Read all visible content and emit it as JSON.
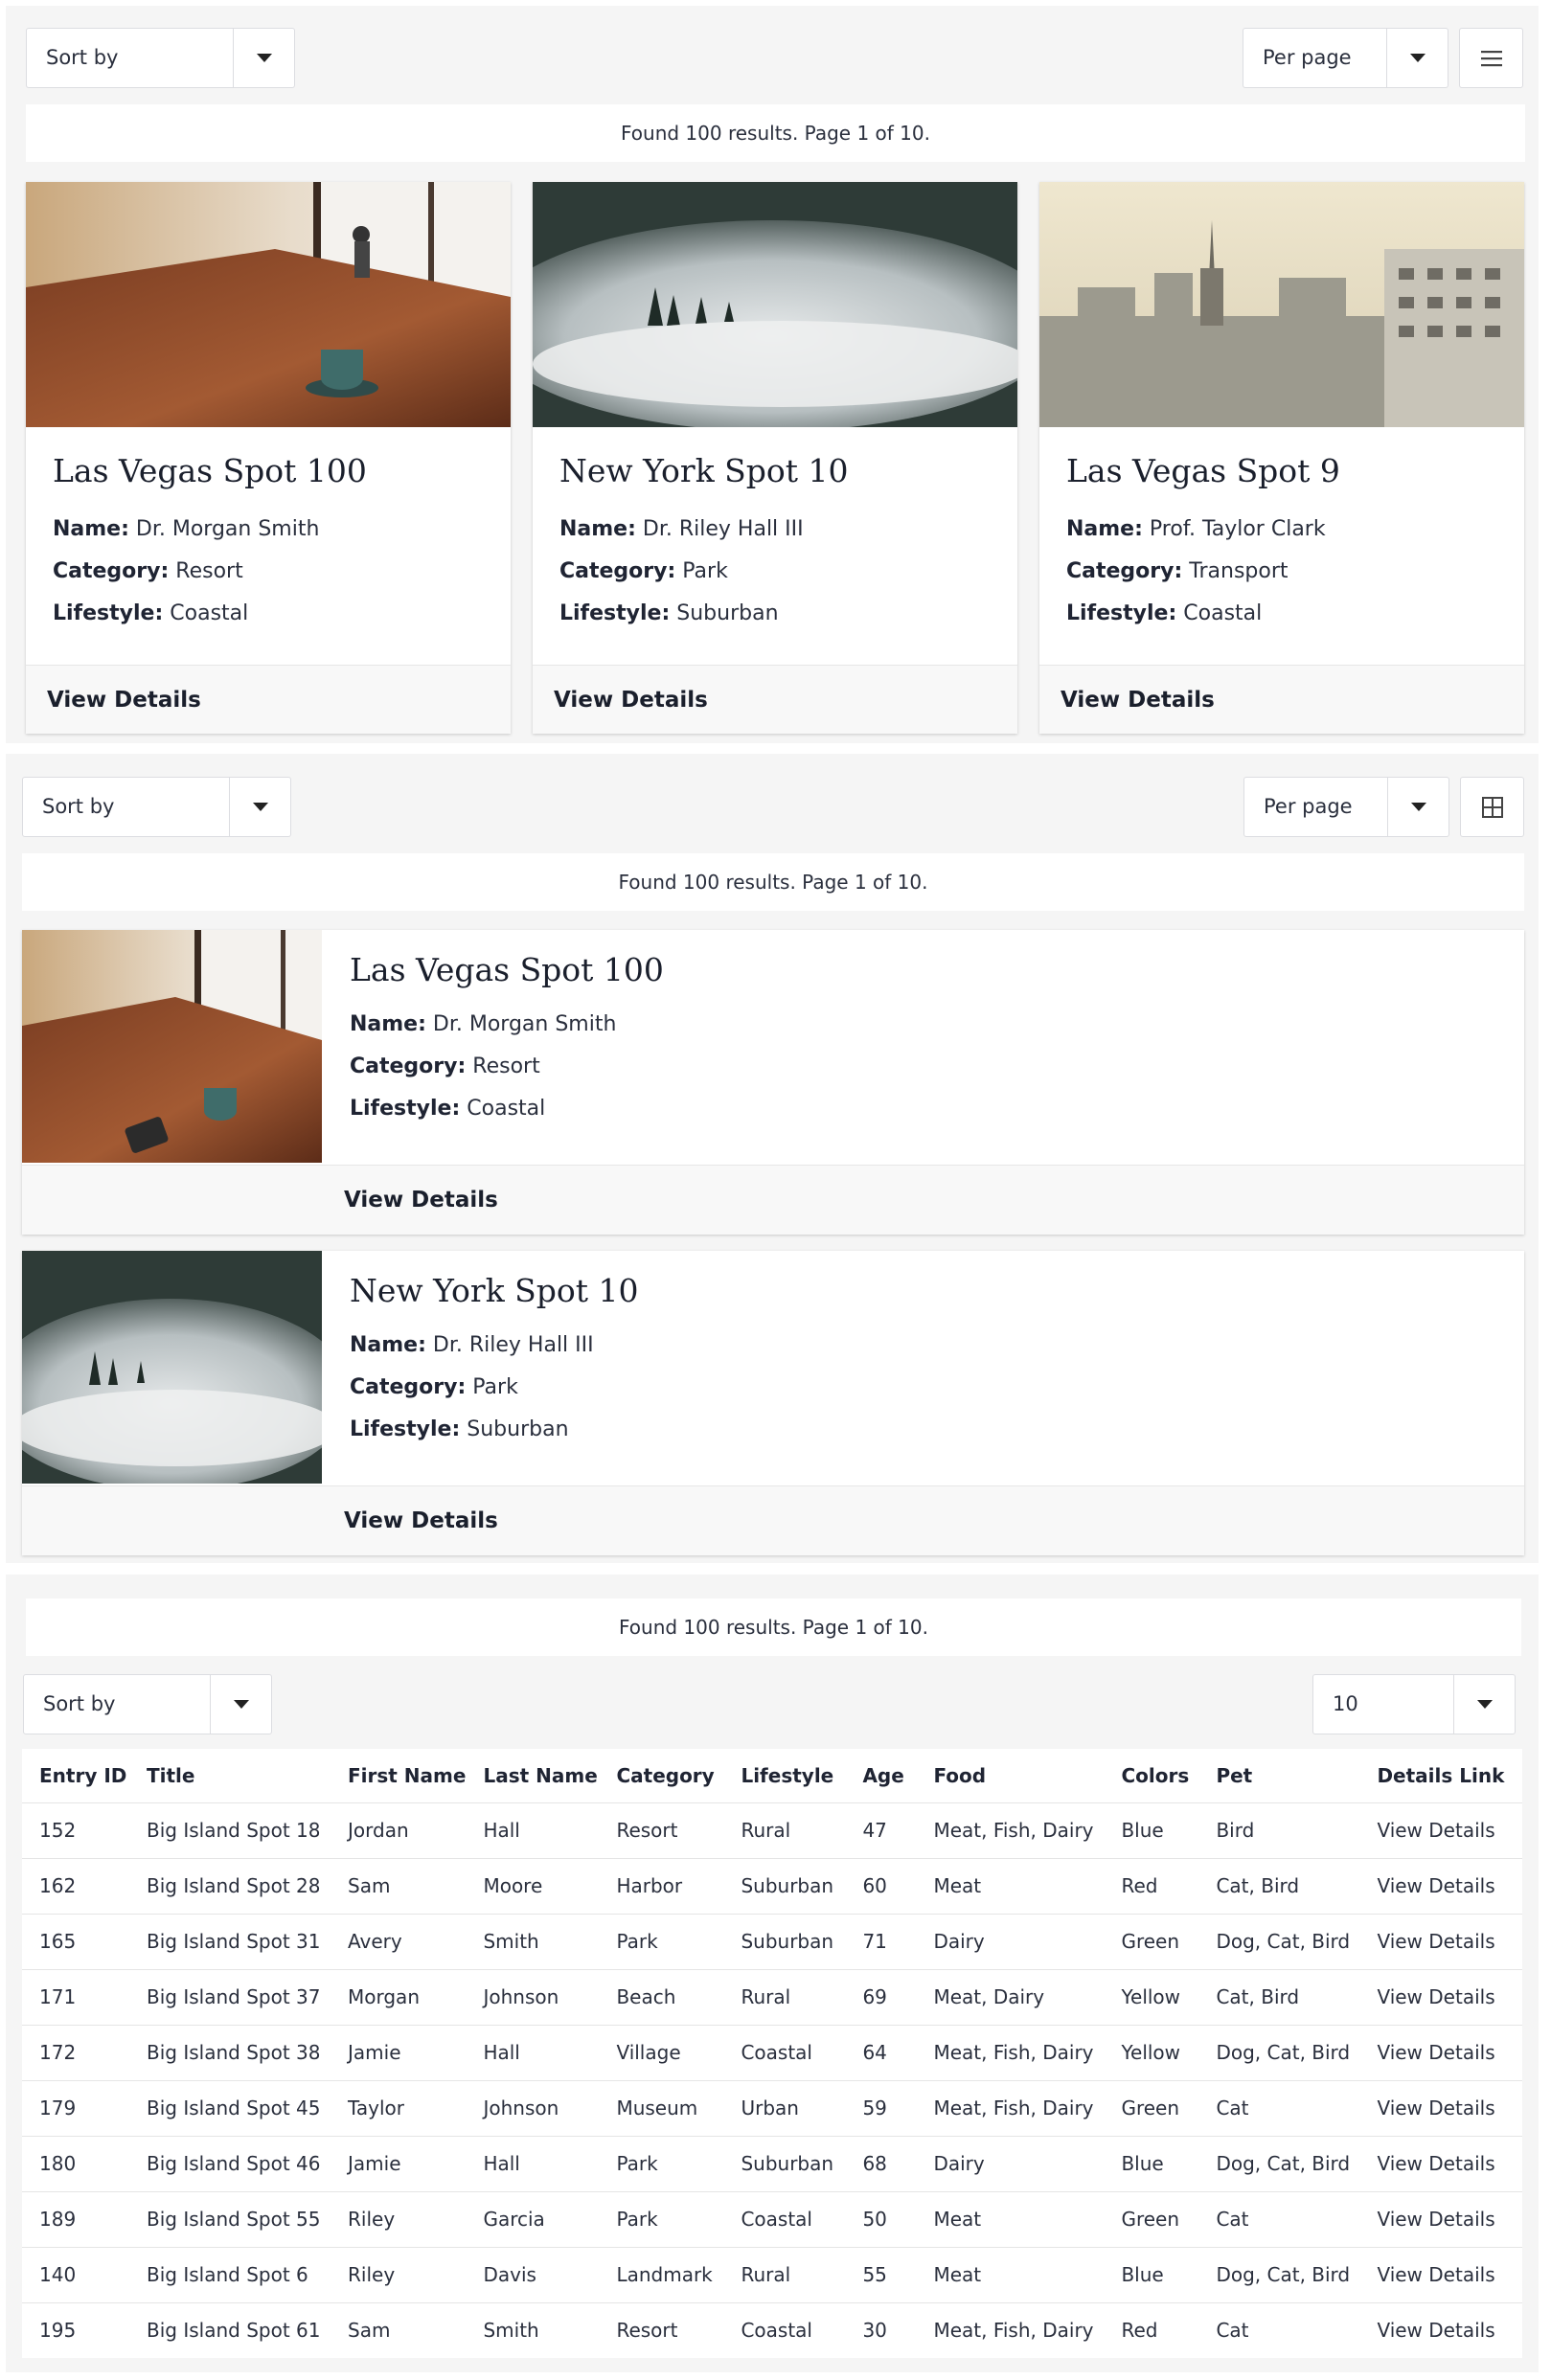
{
  "colors": {
    "bg_section": "#f5f5f5",
    "card_bg": "#ffffff",
    "text": "#1f2433"
  },
  "section1": {
    "sort_label": "Sort by",
    "per_page_label": "Per page",
    "toggle_icon": "list-view-icon",
    "results_text": "Found 100 results. Page 1 of 10.",
    "cards": [
      {
        "title": "Las Vegas Spot 100",
        "name_key": "Name:",
        "name": "Dr. Morgan Smith",
        "category_key": "Category:",
        "category": "Resort",
        "lifestyle_key": "Lifestyle:",
        "lifestyle": "Coastal",
        "link": "View Details",
        "image": "cafe-table-photo"
      },
      {
        "title": "New York Spot 10",
        "name_key": "Name:",
        "name": "Dr. Riley Hall III",
        "category_key": "Category:",
        "category": "Park",
        "lifestyle_key": "Lifestyle:",
        "lifestyle": "Suburban",
        "link": "View Details",
        "image": "foggy-forest-photo"
      },
      {
        "title": "Las Vegas Spot 9",
        "name_key": "Name:",
        "name": "Prof. Taylor Clark",
        "category_key": "Category:",
        "category": "Transport",
        "lifestyle_key": "Lifestyle:",
        "lifestyle": "Coastal",
        "link": "View Details",
        "image": "city-skyline-photo"
      }
    ]
  },
  "section2": {
    "sort_label": "Sort by",
    "per_page_label": "Per page",
    "toggle_icon": "grid-view-icon",
    "results_text": "Found 100 results. Page 1 of 10.",
    "cards": [
      {
        "title": "Las Vegas Spot 100",
        "name_key": "Name:",
        "name": "Dr. Morgan Smith",
        "category_key": "Category:",
        "category": "Resort",
        "lifestyle_key": "Lifestyle:",
        "lifestyle": "Coastal",
        "link": "View Details",
        "image": "cafe-table-photo"
      },
      {
        "title": "New York Spot 10",
        "name_key": "Name:",
        "name": "Dr. Riley Hall III",
        "category_key": "Category:",
        "category": "Park",
        "lifestyle_key": "Lifestyle:",
        "lifestyle": "Suburban",
        "link": "View Details",
        "image": "foggy-forest-photo"
      }
    ]
  },
  "section3": {
    "results_text": "Found 100 results. Page 1 of 10.",
    "sort_label": "Sort by",
    "per_page_value": "10",
    "columns": [
      "Entry ID",
      "Title",
      "First Name",
      "Last Name",
      "Category",
      "Lifestyle",
      "Age",
      "Food",
      "Colors",
      "Pet",
      "Details Link"
    ],
    "rows": [
      [
        "152",
        "Big Island Spot 18",
        "Jordan",
        "Hall",
        "Resort",
        "Rural",
        "47",
        "Meat, Fish, Dairy",
        "Blue",
        "Bird",
        "View Details"
      ],
      [
        "162",
        "Big Island Spot 28",
        "Sam",
        "Moore",
        "Harbor",
        "Suburban",
        "60",
        "Meat",
        "Red",
        "Cat, Bird",
        "View Details"
      ],
      [
        "165",
        "Big Island Spot 31",
        "Avery",
        "Smith",
        "Park",
        "Suburban",
        "71",
        "Dairy",
        "Green",
        "Dog, Cat, Bird",
        "View Details"
      ],
      [
        "171",
        "Big Island Spot 37",
        "Morgan",
        "Johnson",
        "Beach",
        "Rural",
        "69",
        "Meat, Dairy",
        "Yellow",
        "Cat, Bird",
        "View Details"
      ],
      [
        "172",
        "Big Island Spot 38",
        "Jamie",
        "Hall",
        "Village",
        "Coastal",
        "64",
        "Meat, Fish, Dairy",
        "Yellow",
        "Dog, Cat, Bird",
        "View Details"
      ],
      [
        "179",
        "Big Island Spot 45",
        "Taylor",
        "Johnson",
        "Museum",
        "Urban",
        "59",
        "Meat, Fish, Dairy",
        "Green",
        "Cat",
        "View Details"
      ],
      [
        "180",
        "Big Island Spot 46",
        "Jamie",
        "Hall",
        "Park",
        "Suburban",
        "68",
        "Dairy",
        "Blue",
        "Dog, Cat, Bird",
        "View Details"
      ],
      [
        "189",
        "Big Island Spot 55",
        "Riley",
        "Garcia",
        "Park",
        "Coastal",
        "50",
        "Meat",
        "Green",
        "Cat",
        "View Details"
      ],
      [
        "140",
        "Big Island Spot 6",
        "Riley",
        "Davis",
        "Landmark",
        "Rural",
        "55",
        "Meat",
        "Blue",
        "Dog, Cat, Bird",
        "View Details"
      ],
      [
        "195",
        "Big Island Spot 61",
        "Sam",
        "Smith",
        "Resort",
        "Coastal",
        "30",
        "Meat, Fish, Dairy",
        "Red",
        "Cat",
        "View Details"
      ]
    ]
  }
}
